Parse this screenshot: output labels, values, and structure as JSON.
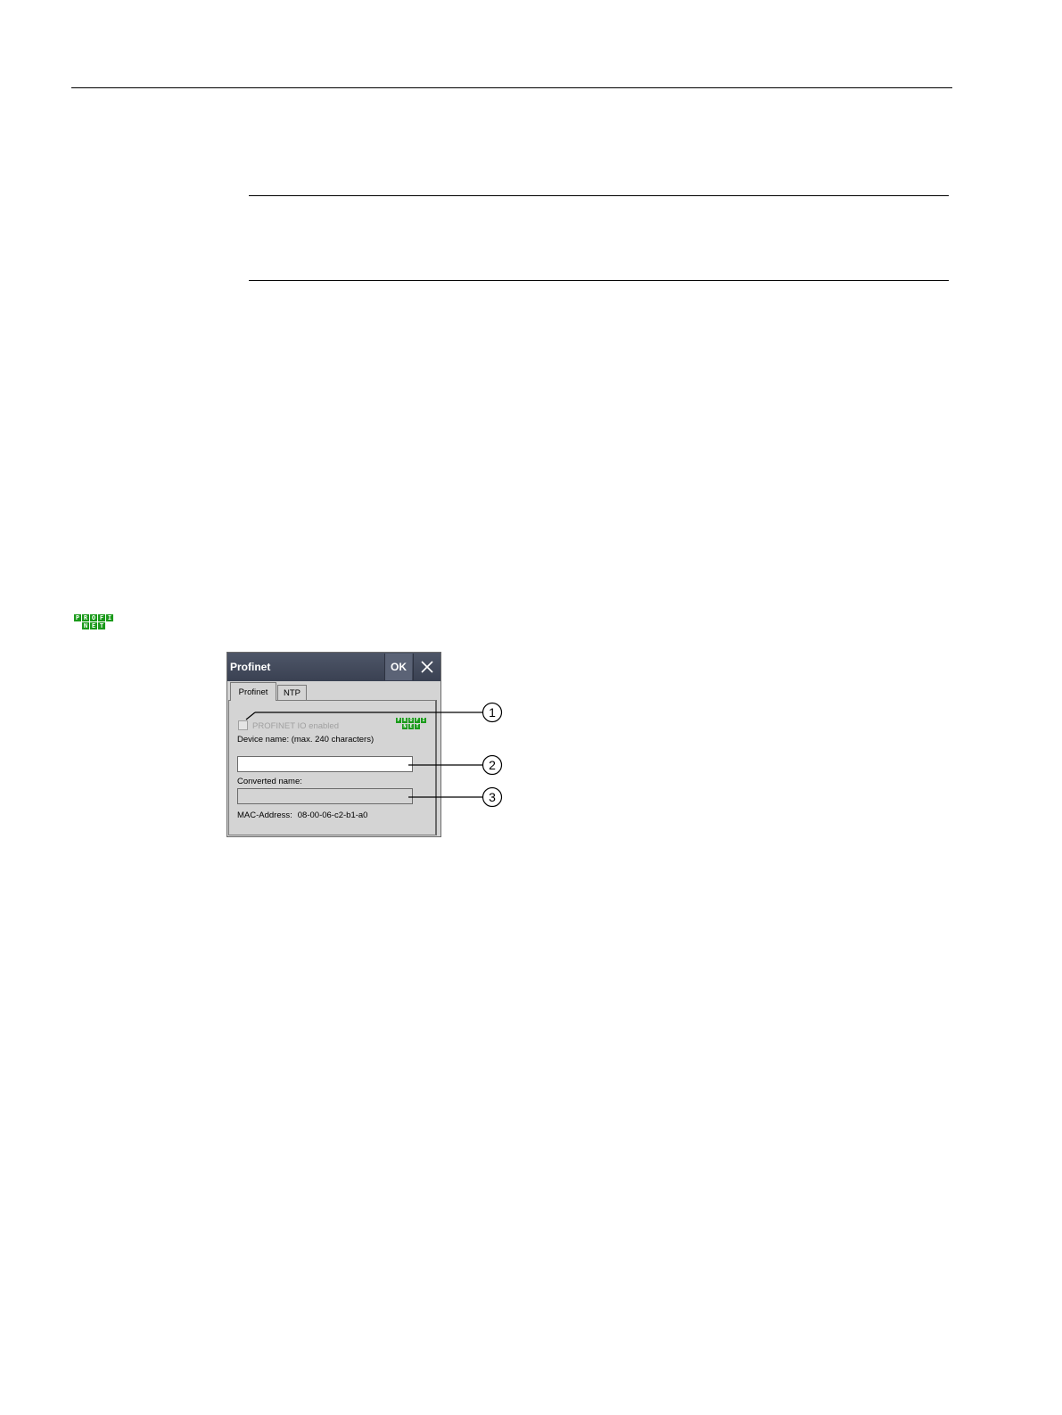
{
  "dialog": {
    "title": "Profinet",
    "ok_label": "OK",
    "close_icon": "close-icon",
    "tabs": [
      {
        "label": "Profinet",
        "active": true
      },
      {
        "label": "NTP",
        "active": false
      }
    ],
    "checkbox_label": "PROFINET IO enabled",
    "checkbox_checked": false,
    "device_name_label": "Device name: (max. 240 characters)",
    "device_name_value": "",
    "converted_name_label": "Converted name:",
    "converted_name_value": "",
    "mac_label": "MAC-Address:",
    "mac_value": "08-00-06-c2-b1-a0"
  },
  "logo": {
    "name": "PROFINET",
    "top_letters": [
      "P",
      "R",
      "O",
      "F",
      "I"
    ],
    "bottom_letters": [
      "N",
      "E",
      "T"
    ],
    "color": "#1a9a1a"
  },
  "callouts": [
    "1",
    "2",
    "3"
  ],
  "colors": {
    "titlebar": "#3a4152",
    "dialog_bg": "#d4d4d4"
  }
}
